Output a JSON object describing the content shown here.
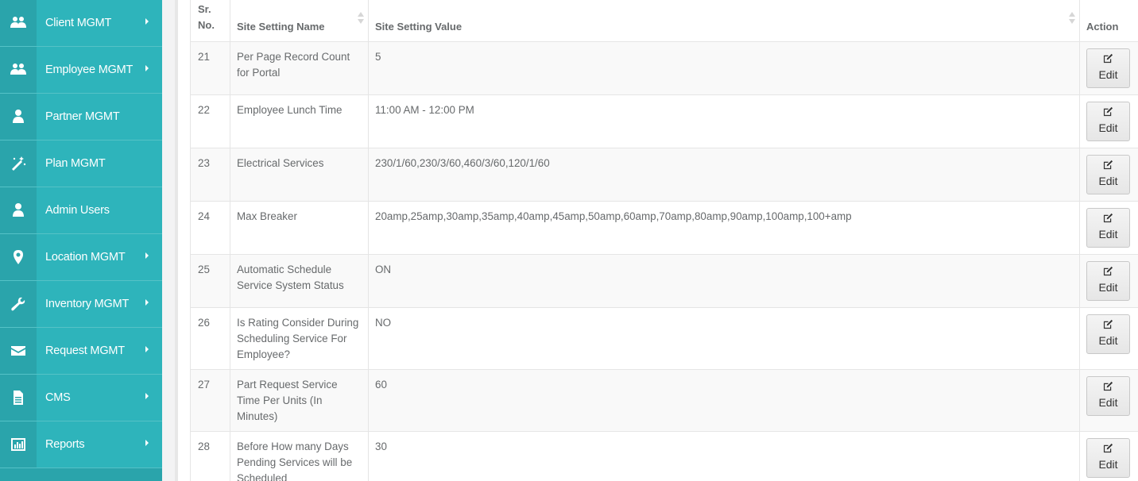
{
  "sidebar": {
    "items": [
      {
        "label": "Client MGMT",
        "icon": "users-icon",
        "has_submenu": true
      },
      {
        "label": "Employee MGMT",
        "icon": "users-icon",
        "has_submenu": true
      },
      {
        "label": "Partner MGMT",
        "icon": "user-icon",
        "has_submenu": false
      },
      {
        "label": "Plan MGMT",
        "icon": "magic-wand-icon",
        "has_submenu": false
      },
      {
        "label": "Admin Users",
        "icon": "user-icon",
        "has_submenu": false
      },
      {
        "label": "Location MGMT",
        "icon": "map-marker-icon",
        "has_submenu": true
      },
      {
        "label": "Inventory MGMT",
        "icon": "wrench-icon",
        "has_submenu": true
      },
      {
        "label": "Request MGMT",
        "icon": "envelope-icon",
        "has_submenu": true
      },
      {
        "label": "CMS",
        "icon": "file-icon",
        "has_submenu": true
      },
      {
        "label": "Reports",
        "icon": "bar-chart-icon",
        "has_submenu": true
      }
    ]
  },
  "table": {
    "headers": {
      "sr_no": "Sr. No.",
      "name": "Site Setting Name",
      "value": "Site Setting Value",
      "action": "Action"
    },
    "edit_label": "Edit",
    "rows": [
      {
        "sr": "21",
        "name": "Per Page Record Count for Portal",
        "value": "5"
      },
      {
        "sr": "22",
        "name": "Employee Lunch Time",
        "value": "11:00 AM - 12:00 PM"
      },
      {
        "sr": "23",
        "name": "Electrical Services",
        "value": "230/1/60,230/3/60,460/3/60,120/1/60"
      },
      {
        "sr": "24",
        "name": "Max Breaker",
        "value": "20amp,25amp,30amp,35amp,40amp,45amp,50amp,60amp,70amp,80amp,90amp,100amp,100+amp"
      },
      {
        "sr": "25",
        "name": "Automatic Schedule Service System Status",
        "value": "ON"
      },
      {
        "sr": "26",
        "name": "Is Rating Consider During Scheduling Service For Employee?",
        "value": "NO"
      },
      {
        "sr": "27",
        "name": "Part Request Service Time Per Units (In Minutes)",
        "value": "60"
      },
      {
        "sr": "28",
        "name": "Before How many Days Pending Services will be Scheduled",
        "value": "30"
      }
    ]
  },
  "colors": {
    "sidebar_bg": "#2eb4bb",
    "sidebar_icon_bg": "#2aa4ab",
    "text": "#676a6c"
  }
}
